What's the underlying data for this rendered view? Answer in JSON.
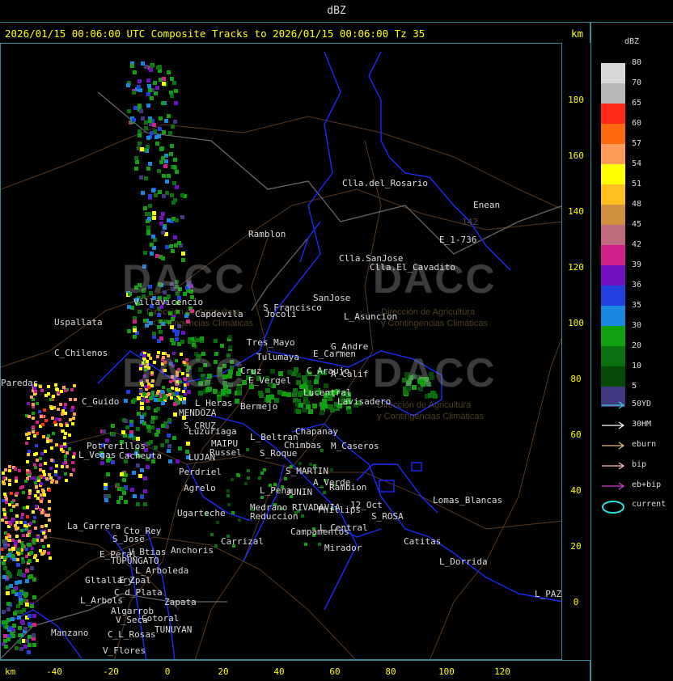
{
  "header": {
    "title": "dBZ"
  },
  "map_title": "2026/01/15 00:06:00 UTC Composite Tracks to 2026/01/15 00:06:00 Tz 35",
  "km_label": "km",
  "y_axis": [
    180,
    160,
    140,
    120,
    100,
    80,
    60,
    40,
    20,
    0
  ],
  "x_axis": [
    -40,
    -20,
    0,
    20,
    40,
    60,
    80,
    100,
    120
  ],
  "legend": {
    "title": "dBZ",
    "levels": [
      {
        "label": "80",
        "color": "#d8d8d8"
      },
      {
        "label": "70",
        "color": "#b8b8b8"
      },
      {
        "label": "65",
        "color": "#ff2a1a"
      },
      {
        "label": "60",
        "color": "#ff6a10"
      },
      {
        "label": "57",
        "color": "#ff9a5a"
      },
      {
        "label": "54",
        "color": "#ffff00"
      },
      {
        "label": "51",
        "color": "#ffc020"
      },
      {
        "label": "48",
        "color": "#d09040"
      },
      {
        "label": "45",
        "color": "#c06a80"
      },
      {
        "label": "42",
        "color": "#d0208a"
      },
      {
        "label": "39",
        "color": "#7010c0"
      },
      {
        "label": "36",
        "color": "#2040e0"
      },
      {
        "label": "35",
        "color": "#1a88e0"
      },
      {
        "label": "30",
        "color": "#10a010"
      },
      {
        "label": "20",
        "color": "#0a7010"
      },
      {
        "label": "10",
        "color": "#064a08"
      },
      {
        "label": "5",
        "color": "#403880"
      }
    ],
    "tracks": [
      {
        "label": "50YD",
        "color": "#40c8d8"
      },
      {
        "label": "30HM",
        "color": "#ffffff"
      },
      {
        "label": "eburn",
        "color": "#e0c080"
      },
      {
        "label": "bip",
        "color": "#ffc0c0"
      },
      {
        "label": "eb+bip",
        "color": "#d040d0"
      }
    ],
    "current_label": "current",
    "current_color": "#30e0e0"
  },
  "watermark": {
    "brand": "DACC",
    "line1": "Dirección de Agricultura",
    "line2": "y Contingencias Climáticas"
  },
  "places": [
    "Clla.del_Rosario",
    "Enean",
    "142",
    "E_1-736",
    "Ramblon",
    "Clla.SanJose",
    "Clla.El_Cavadito",
    "Villavicencio",
    "Capdevila",
    "S_Francisco",
    "SanJose",
    "L_Asuncion",
    "Uspallata",
    "Tres_Mayo",
    "Tulumaya",
    "G_Andre",
    "E_Carmen",
    "C_Chilenos",
    "C_Araujo",
    "A_Calif",
    "E_Vergel",
    "Cruz",
    "Paredas",
    "Lavisadero",
    "C_Guido",
    "L_Heras",
    "Bermejo",
    "MENDOZA",
    "Lucentral",
    "Jocoli",
    "Luzuriaga",
    "Chapanay",
    "S_CRUZ",
    "L_Beltran",
    "MAIPU",
    "Potrerillos",
    "Chimbas",
    "M_Caseros",
    "Cacheuta",
    "Russel",
    "S_Roque",
    "L_Vegas",
    "LUJAN",
    "Perdriel",
    "Agrelo",
    "S_MARTIN",
    "Rambion",
    "A_Verde",
    "L_Pena",
    "JUNIN",
    "Lomas_Blancas",
    "Ugarteche",
    "Medrano",
    "RIVADAVIA",
    "12_Oct",
    "S_ROSA",
    "Reduccion",
    "Phillips",
    "La_Carrera",
    "Cto_Rey",
    "Carrizal",
    "Campamentos",
    "L_Central",
    "S_Jose",
    "Catitas",
    "E_Peral",
    "V_Btias",
    "Anchoris",
    "Mirador",
    "TUPUNGATO",
    "L_Dorrida",
    "L_Arboleda",
    "Gltallary",
    "E_Zpal",
    "C_d_Plata",
    "L_Arbols",
    "Zapata",
    "Algarrob",
    "V_Seca",
    "Cotoral",
    "L_PAZ",
    "TUNUYAN",
    "Manzano",
    "C_L_Rosas",
    "V_Flores",
    "Cruz_del"
  ]
}
